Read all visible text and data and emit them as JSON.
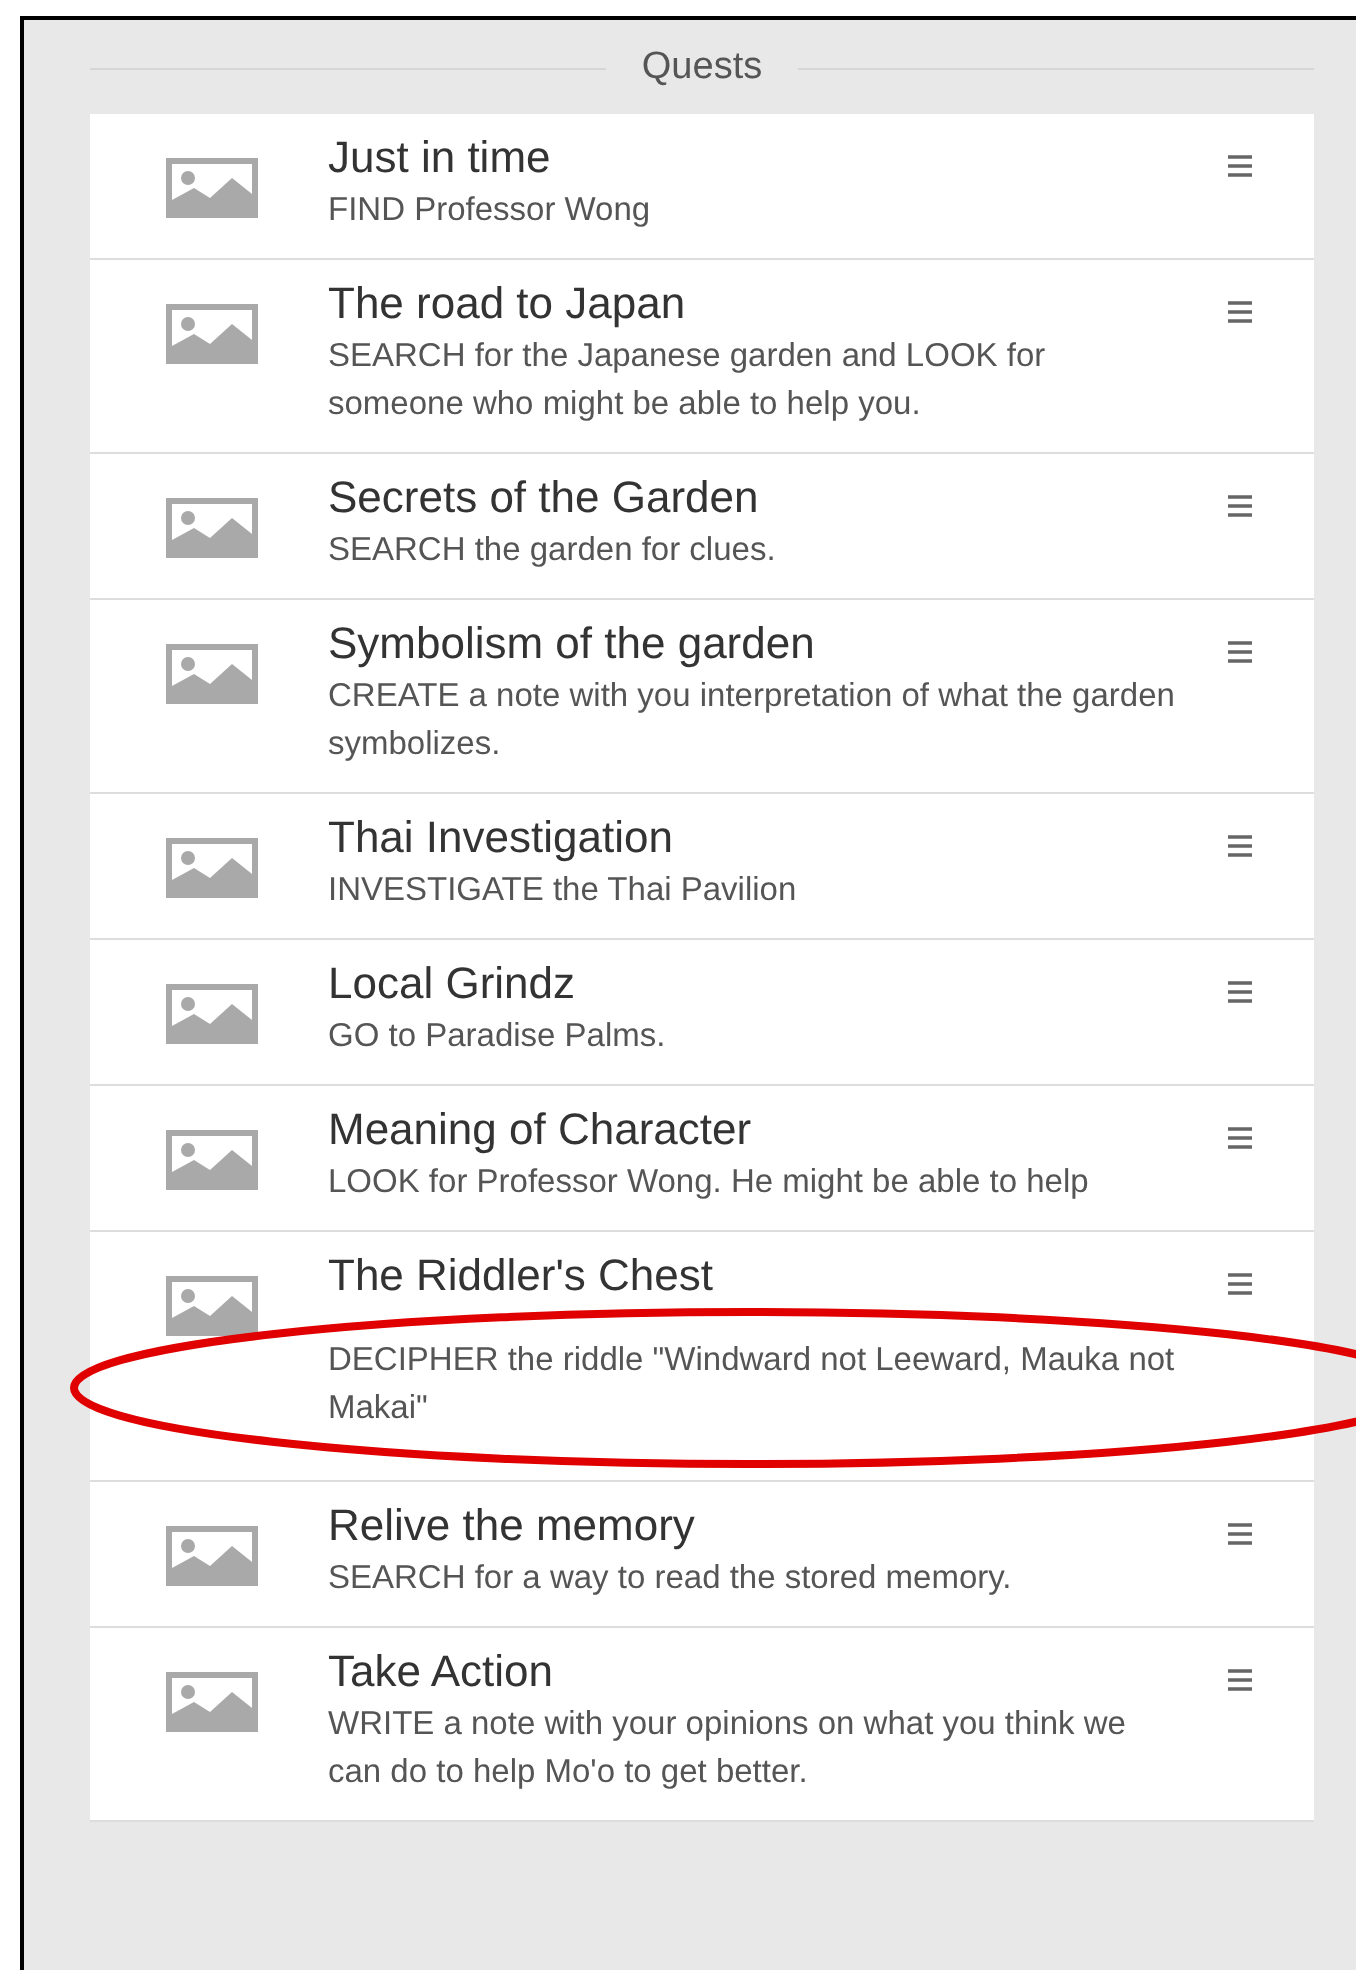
{
  "panel": {
    "title": "Quests"
  },
  "quests": [
    {
      "title": "Just in time",
      "description": "FIND Professor Wong",
      "circled": false
    },
    {
      "title": "The road to Japan",
      "description": "SEARCH for the Japanese garden and LOOK for someone who might be able to help you.",
      "circled": false
    },
    {
      "title": "Secrets of the Garden",
      "description": "SEARCH the garden for clues.",
      "circled": false
    },
    {
      "title": "Symbolism of the garden",
      "description": "CREATE a note with you interpretation of what the garden symbolizes.",
      "circled": false
    },
    {
      "title": "Thai Investigation",
      "description": "INVESTIGATE the Thai Pavilion",
      "circled": false
    },
    {
      "title": "Local Grindz",
      "description": "GO to Paradise Palms.",
      "circled": false
    },
    {
      "title": "Meaning of Character",
      "description": "LOOK for Professor Wong. He might be able to help",
      "circled": false
    },
    {
      "title": "The Riddler's Chest",
      "description": "DECIPHER the riddle \"Windward not Leeward, Mauka not Makai\"",
      "circled": true
    },
    {
      "title": "Relive the memory",
      "description": "SEARCH for a way to read the stored memory.",
      "circled": false
    },
    {
      "title": "Take Action",
      "description": "WRITE a note with your opinions on what you think we can do to help Mo'o to get better.",
      "circled": false
    }
  ]
}
